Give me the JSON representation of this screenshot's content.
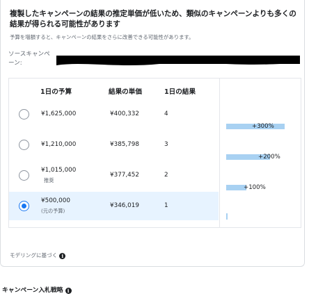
{
  "headline": "複製したキャンペーンの結果の推定単価が低いため、類似のキャンペーンよりも多くの結果が得られる可能性があります",
  "subtext": "予算を増額すると、キャンペーンの結果をさらに改善できる可能性があります。",
  "source": {
    "label": "ソースキャンペーン:",
    "value_redacted": true
  },
  "table": {
    "headers": [
      "1日の予算",
      "結果の単価",
      "1日の結果"
    ],
    "rows": [
      {
        "budget": "¥1,625,000",
        "note": "",
        "cost": "¥400,332",
        "results": "4",
        "selected": false,
        "increase": "+300%",
        "increase_ratio": 1.0
      },
      {
        "budget": "¥1,210,000",
        "note": "",
        "cost": "¥385,798",
        "results": "3",
        "selected": false,
        "increase": "+200%",
        "increase_ratio": 0.75
      },
      {
        "budget": "¥1,015,000",
        "note": "推奨",
        "cost": "¥377,452",
        "results": "2",
        "selected": false,
        "increase": "+100%",
        "increase_ratio": 0.35
      },
      {
        "budget": "¥500,000",
        "note": "(元の予算)",
        "cost": "¥346,019",
        "results": "1",
        "selected": true,
        "increase": "",
        "increase_ratio": 0.0
      }
    ]
  },
  "footer": {
    "modeling": "モデリングに基づく"
  },
  "strategy": {
    "title": "キャンペーン入札戦略"
  },
  "colors": {
    "accent": "#1877f2",
    "bar": "#a8d1f2",
    "selected_row": "#e7f3ff"
  }
}
